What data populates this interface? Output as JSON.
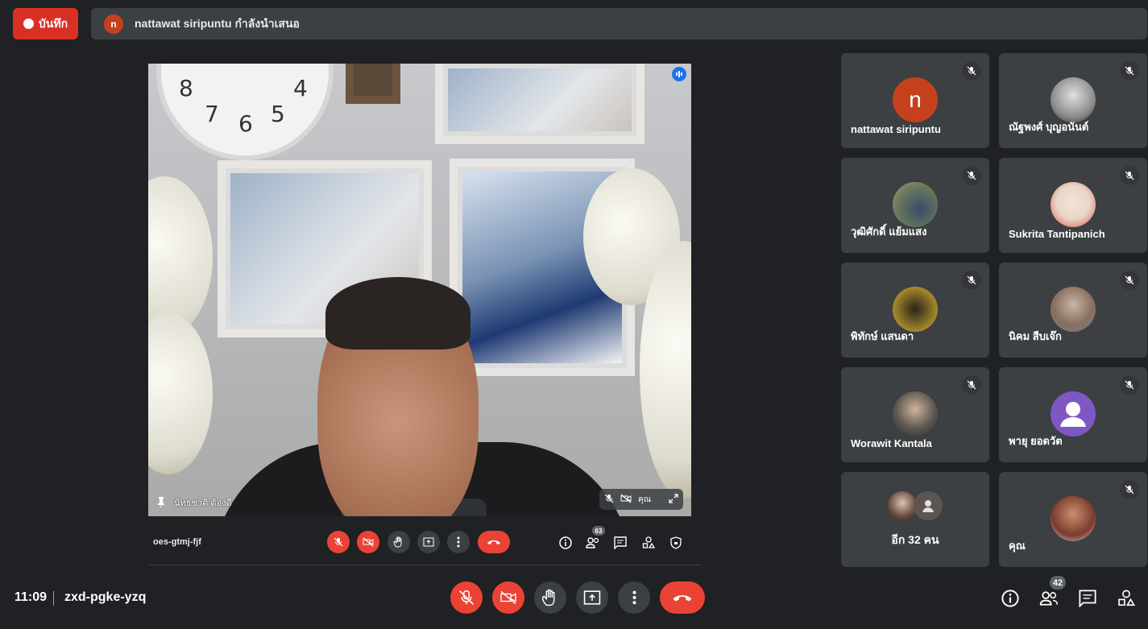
{
  "top_bar": {
    "record_label": "บันทึก",
    "presenter_initial": "n",
    "presenting_text": "nattawat siripuntu กำลังนำเสนอ"
  },
  "presentation": {
    "clock_numbers": [
      "8",
      "7",
      "6",
      "5",
      "4"
    ],
    "pinned_name": "นัทธชาติ ต้องดี",
    "self_view_label": "คุณ",
    "inner_meeting_code": "oes-gtmj-fjf",
    "inner_people_count": "63"
  },
  "participants": [
    {
      "name": "nattawat siripuntu",
      "avatar_type": "letter",
      "initial": "n",
      "color": "#c5411c",
      "muted": true
    },
    {
      "name": "ณัฐพงศ์ บุญอนันต์",
      "avatar_type": "photo",
      "color": "#8d8d8d",
      "muted": true
    },
    {
      "name": "วุฒิศักดิ์ แย้มแสง",
      "avatar_type": "photo",
      "color": "#6a7a5a",
      "muted": true
    },
    {
      "name": "Sukrita Tantipanich",
      "avatar_type": "photo",
      "color": "#e9d6c8",
      "muted": true
    },
    {
      "name": "พิทักษ์ แสนดา",
      "avatar_type": "photo",
      "color": "#a88a2c",
      "muted": true
    },
    {
      "name": "นิคม สืบเจ๊ก",
      "avatar_type": "photo",
      "color": "#8a6f5f",
      "muted": true
    },
    {
      "name": "Worawit Kantala",
      "avatar_type": "photo",
      "color": "#5b5750",
      "muted": true
    },
    {
      "name": "พายุ ยอดวัต",
      "avatar_type": "default",
      "color": "#7e57c2",
      "muted": true
    },
    {
      "name": "อีก 32 คน",
      "avatar_type": "overflow",
      "muted": false
    },
    {
      "name": "คุณ",
      "avatar_type": "photo",
      "color": "#7b3a2e",
      "muted": true
    }
  ],
  "bottom_bar": {
    "time": "11:09",
    "meeting_code": "zxd-pgke-yzq",
    "people_count": "42"
  },
  "colors": {
    "background": "#202124",
    "tile": "#3c4043",
    "danger": "#ea4335",
    "accent": "#1a73e8"
  },
  "icons": [
    "mic-off-icon",
    "camera-off-icon",
    "raise-hand-icon",
    "present-icon",
    "more-icon",
    "hang-up-icon",
    "info-icon",
    "people-icon",
    "chat-icon",
    "activities-icon",
    "host-controls-icon"
  ]
}
